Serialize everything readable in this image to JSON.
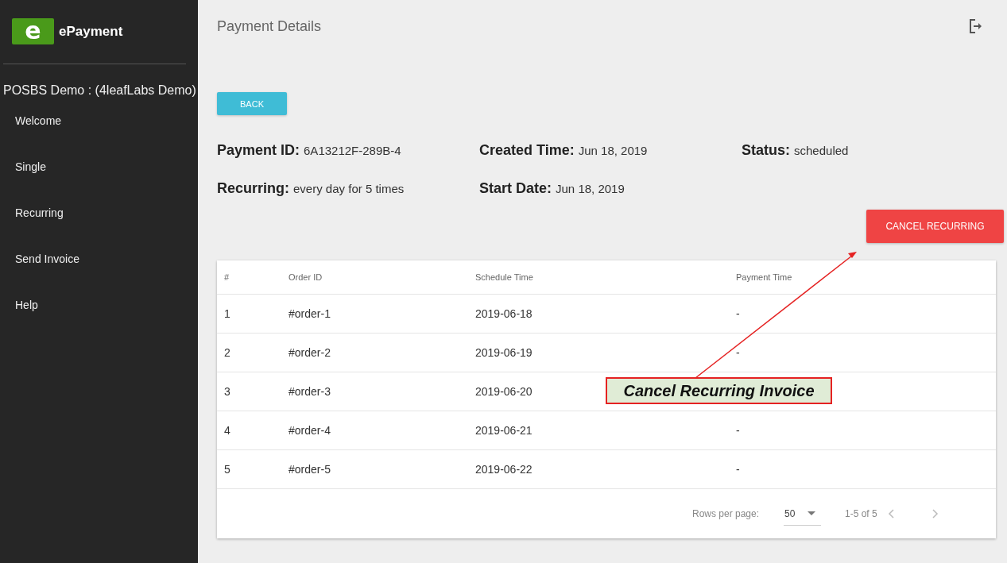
{
  "sidebar": {
    "logo_letter": "e",
    "app_name": "ePayment",
    "account": "POSBS Demo : (4leafLabs Demo)",
    "items": [
      {
        "label": "Welcome"
      },
      {
        "label": "Single"
      },
      {
        "label": "Recurring"
      },
      {
        "label": "Send Invoice"
      },
      {
        "label": "Help"
      }
    ]
  },
  "header": {
    "title": "Payment Details"
  },
  "back_button": "BACK",
  "fields": [
    {
      "label": "Payment ID:",
      "value": "6A13212F-289B-4"
    },
    {
      "label": "Created Time:",
      "value": "Jun 18, 2019"
    },
    {
      "label": "Status:",
      "value": "scheduled"
    },
    {
      "label": "Recurring:",
      "value": "every day for 5 times"
    },
    {
      "label": "Start Date:",
      "value": "Jun 18, 2019"
    }
  ],
  "cancel_button": "CANCEL RECURRING",
  "table": {
    "columns": [
      "#",
      "Order ID",
      "Schedule Time",
      "Payment Time"
    ],
    "rows": [
      [
        "1",
        "#order-1",
        "2019-06-18",
        "-"
      ],
      [
        "2",
        "#order-2",
        "2019-06-19",
        "-"
      ],
      [
        "3",
        "#order-3",
        "2019-06-20",
        ""
      ],
      [
        "4",
        "#order-4",
        "2019-06-21",
        "-"
      ],
      [
        "5",
        "#order-5",
        "2019-06-22",
        "-"
      ]
    ],
    "footer": {
      "rows_per_page_label": "Rows per page:",
      "rows_per_page": "50",
      "range": "1-5 of 5"
    }
  },
  "callout": {
    "text": "Cancel Recurring Invoice"
  }
}
